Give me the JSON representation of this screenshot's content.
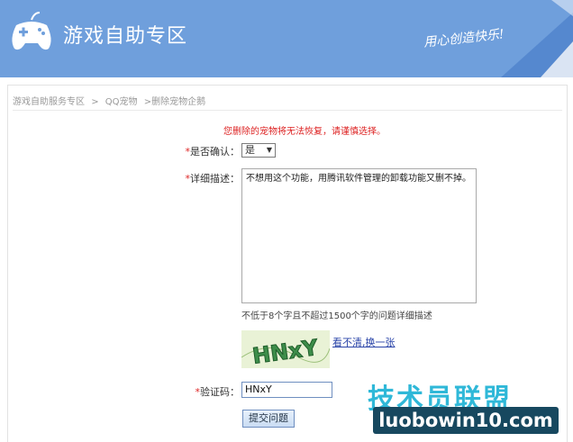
{
  "header": {
    "title": "游戏自助专区",
    "slogan": "用心创造快乐!"
  },
  "breadcrumb": {
    "items": [
      "游戏自助服务专区",
      ">",
      "QQ宠物",
      ">删除宠物企鹅"
    ]
  },
  "form": {
    "warning": "您删除的宠物将无法恢复，请谨慎选择。",
    "confirm": {
      "required": "*",
      "label": "是否确认：",
      "value": "是"
    },
    "description": {
      "required": "*",
      "label": "详细描述：",
      "value": "不想用这个功能，用腾讯软件管理的卸载功能又删不掉。",
      "hint": "不低于8个字且不超过1500个字的问题详细描述"
    },
    "captcha": {
      "image_text": "HNxY",
      "refresh_link": "看不清,换一张",
      "required": "*",
      "label": "验证码：",
      "value": "HNxY"
    },
    "submit_label": "提交问题"
  },
  "watermark": {
    "title": "技术员联盟",
    "url": "luobowin10.com"
  },
  "colors": {
    "header_bg": "#6f9fdc",
    "warning": "#dd2222",
    "link": "#2a44a8"
  }
}
